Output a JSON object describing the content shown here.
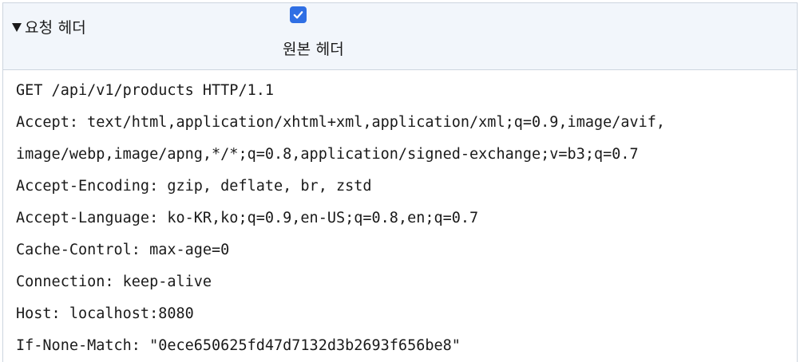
{
  "section": {
    "title": "요청 헤더",
    "raw_toggle_label": "원본 헤더",
    "raw_toggle_checked": true,
    "accent_color": "#2f6fe4",
    "header_background": "#f2f6fb"
  },
  "raw_lines": [
    "GET /api/v1/products HTTP/1.1",
    "Accept: text/html,application/xhtml+xml,application/xml;q=0.9,image/avif,",
    "image/webp,image/apng,*/*;q=0.8,application/signed-exchange;v=b3;q=0.7",
    "Accept-Encoding: gzip, deflate, br, zstd",
    "Accept-Language: ko-KR,ko;q=0.9,en-US;q=0.8,en;q=0.7",
    "Cache-Control: max-age=0",
    "Connection: keep-alive",
    "Host: localhost:8080",
    "If-None-Match: \"0ece650625fd47d7132d3b2693f656be8\""
  ]
}
